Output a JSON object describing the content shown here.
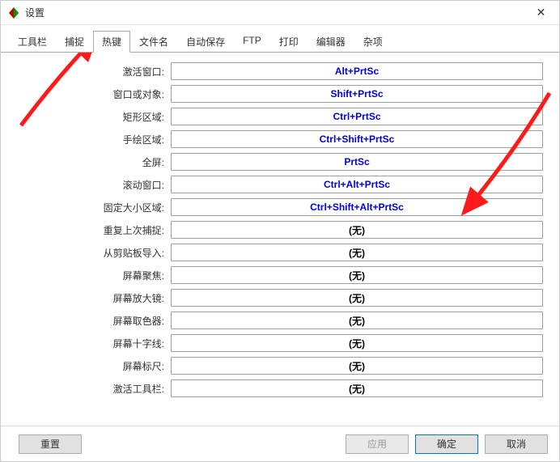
{
  "window": {
    "title": "设置",
    "close_glyph": "✕"
  },
  "tabs": [
    {
      "label": "工具栏"
    },
    {
      "label": "捕捉"
    },
    {
      "label": "热键",
      "active": true
    },
    {
      "label": "文件名"
    },
    {
      "label": "自动保存"
    },
    {
      "label": "FTP"
    },
    {
      "label": "打印"
    },
    {
      "label": "编辑器"
    },
    {
      "label": "杂项"
    }
  ],
  "hotkeys": {
    "rows": [
      {
        "label": "激活窗口:",
        "value": "Alt+PrtSc",
        "blue": true
      },
      {
        "label": "窗口或对象:",
        "value": "Shift+PrtSc",
        "blue": true
      },
      {
        "label": "矩形区域:",
        "value": "Ctrl+PrtSc",
        "blue": true
      },
      {
        "label": "手绘区域:",
        "value": "Ctrl+Shift+PrtSc",
        "blue": true
      },
      {
        "label": "全屏:",
        "value": "PrtSc",
        "blue": true
      },
      {
        "label": "滚动窗口:",
        "value": "Ctrl+Alt+PrtSc",
        "blue": true
      },
      {
        "label": "固定大小区域:",
        "value": "Ctrl+Shift+Alt+PrtSc",
        "blue": true
      },
      {
        "label": "重复上次捕捉:",
        "value": "(无)",
        "blue": false
      },
      {
        "label": "从剪贴板导入:",
        "value": "(无)",
        "blue": false
      },
      {
        "label": "屏幕聚焦:",
        "value": "(无)",
        "blue": false
      },
      {
        "label": "屏幕放大镜:",
        "value": "(无)",
        "blue": false
      },
      {
        "label": "屏幕取色器:",
        "value": "(无)",
        "blue": false
      },
      {
        "label": "屏幕十字线:",
        "value": "(无)",
        "blue": false
      },
      {
        "label": "屏幕标尺:",
        "value": "(无)",
        "blue": false
      },
      {
        "label": "激活工具栏:",
        "value": "(无)",
        "blue": false
      }
    ]
  },
  "footer": {
    "reset": "重置",
    "apply": "应用",
    "ok": "确定",
    "cancel": "取消"
  }
}
